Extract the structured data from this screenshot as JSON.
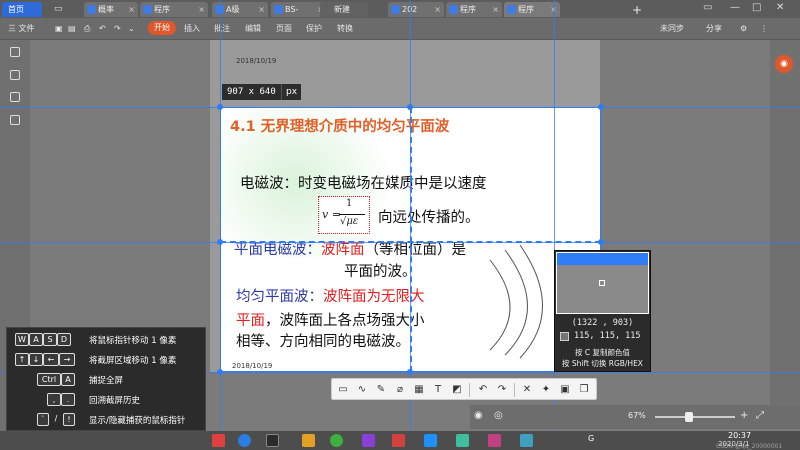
{
  "tabs": {
    "home": "首页",
    "items": [
      "概率",
      "程序",
      "A级",
      "BS-",
      "新建",
      "202",
      "程序",
      "程序"
    ]
  },
  "toolbar": {
    "file": "三 文件",
    "start": "开始",
    "insert": "插入",
    "review": "批注",
    "edit": "编辑",
    "page": "页面",
    "protect": "保护",
    "convert": "转换",
    "sync": "未同步",
    "share": "分享"
  },
  "document": {
    "header_date": "2018/10/19",
    "footer_date": "2018/10/19",
    "title": "4.1  无界理想介质中的均匀平面波",
    "line1": "电磁波：时变电磁场在媒质中是以速度",
    "formula_v": "v =",
    "formula_num": "1",
    "formula_den": "√με",
    "line2": "向远处传播的。",
    "plane_term": "平面电磁波：",
    "plane_red": "波阵面",
    "plane_rest": "（等相位面）是",
    "plane_line2": "平面的波。",
    "uniform_term": "均匀平面波：",
    "uniform_red": "波阵面为无限大",
    "u2_red": "平面",
    "u2_rest": "，波阵面上各点场强大小",
    "u3": "相等、方向相同的电磁波。"
  },
  "capture": {
    "size": "907 x 640",
    "unit": "px"
  },
  "magnifier": {
    "coords": "(1322 , 903)",
    "rgb": "115, 115, 115",
    "hint_c": "按 C 复制颜色值",
    "hint_shift": "按 Shift 切换 RGB/HEX"
  },
  "shortcuts": [
    {
      "keys": [
        "W",
        "A",
        "S",
        "D"
      ],
      "text": "将鼠标指针移动 1 像素"
    },
    {
      "keys": [
        "↑",
        "↓",
        "←",
        "→"
      ],
      "text": "将截屏区域移动 1 像素"
    },
    {
      "keys": [
        "Ctrl",
        "A"
      ],
      "text": "捕捉全屏"
    },
    {
      "keys": [
        ",",
        "."
      ],
      "text": "回溯截屏历史"
    },
    {
      "keys": [
        "`",
        "/",
        "!"
      ],
      "text": "显示/隐藏捕获的鼠标指针"
    }
  ],
  "status": {
    "zoom": "67%"
  },
  "taskbar": {
    "time": "20:37",
    "date": "2020/3/1",
    "lang": "G",
    "watermark": "CSDN @qq_20000001"
  },
  "colors": {
    "accent": "#2e7cf6",
    "title_orange": "#e0602a",
    "term_blue": "#2f3aa6",
    "highlight_red": "#e02020"
  }
}
